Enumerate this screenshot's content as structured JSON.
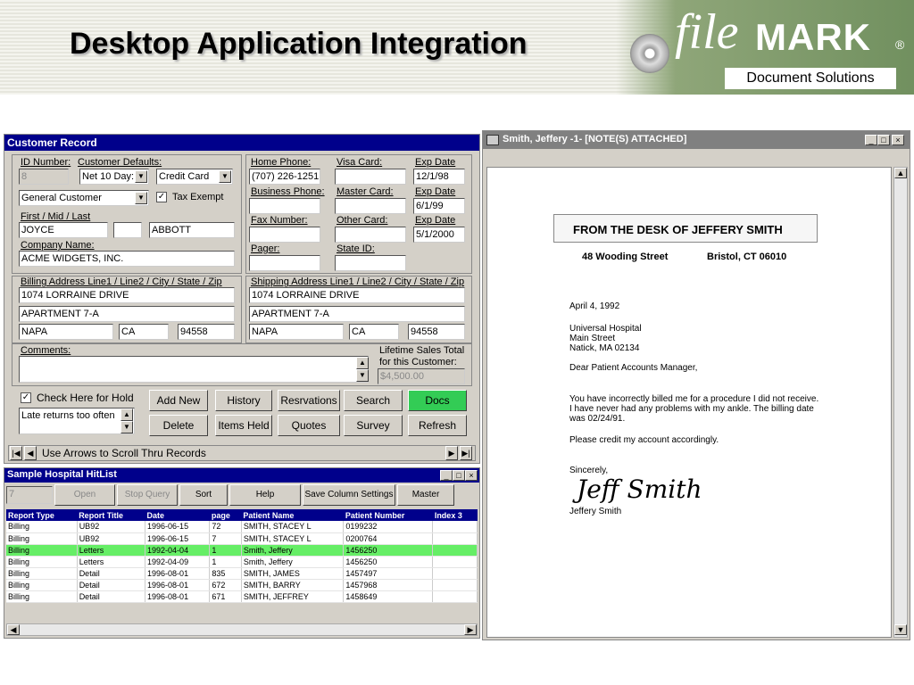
{
  "header": {
    "title": "Desktop Application Integration",
    "logo_file": "file",
    "logo_mark": "MARK",
    "logo_reg": "®",
    "logo_subtitle": "Document Solutions"
  },
  "customer_record": {
    "title": "Customer Record",
    "id_label": "ID Number:",
    "id_value": "8",
    "defaults_label": "Customer Defaults:",
    "terms_value": "Net 10 Day:",
    "payment_value": "Credit Card",
    "customer_type_value": "General Customer",
    "tax_exempt_label": "Tax Exempt",
    "name_label": "First / Mid / Last",
    "first_name": "JOYCE",
    "middle_name": "",
    "last_name": "ABBOTT",
    "company_label": "Company Name:",
    "company_value": "ACME WIDGETS, INC.",
    "home_phone_label": "Home Phone:",
    "home_phone_value": "(707) 226-1251",
    "business_phone_label": "Business Phone:",
    "business_phone_value": "",
    "fax_label": "Fax Number:",
    "fax_value": "",
    "pager_label": "Pager:",
    "pager_value": "",
    "visa_label": "Visa Card:",
    "master_label": "Master Card:",
    "other_label": "Other Card:",
    "state_id_label": "State ID:",
    "exp_label": "Exp Date",
    "exp1": "12/1/98",
    "exp2": "6/1/99",
    "exp3": "5/1/2000",
    "billing_label": "Billing Address Line1 / Line2 / City / State / Zip",
    "billing_line1": "1074 LORRAINE DRIVE",
    "billing_line2": "APARTMENT 7-A",
    "billing_city": "NAPA",
    "billing_state": "CA",
    "billing_zip": "94558",
    "shipping_label": "Shipping Address Line1 / Line2 / City / State / Zip",
    "shipping_line1": "1074 LORRAINE DRIVE",
    "shipping_line2": "APARTMENT 7-A",
    "shipping_city": "NAPA",
    "shipping_state": "CA",
    "shipping_zip": "94558",
    "comments_label": "Comments:",
    "lifetime_label1": "Lifetime Sales Total",
    "lifetime_label2": "for this Customer:",
    "lifetime_value": "$4,500.00",
    "hold_label": "Check Here for Hold",
    "hold_note": "Late returns too often",
    "buttons": {
      "add_new": "Add New",
      "history": "History",
      "reservations": "Resrvations",
      "search": "Search",
      "docs": "Docs",
      "delete": "Delete",
      "items_held": "Items Held",
      "quotes": "Quotes",
      "survey": "Survey",
      "refresh": "Refresh"
    },
    "nav_text": "Use Arrows to Scroll Thru Records"
  },
  "hitlist": {
    "title": "Sample Hospital HitList",
    "count_value": "7",
    "buttons": {
      "open": "Open",
      "stop_query": "Stop Query",
      "sort": "Sort",
      "help": "Help",
      "save_columns": "Save Column Settings",
      "master": "Master"
    },
    "columns": [
      "Report Type",
      "Report Title",
      "Date",
      "page",
      "Patient Name",
      "Patient Number",
      "Index 3"
    ],
    "rows": [
      [
        "Billing",
        "UB92",
        "1996-06-15",
        "72",
        "SMITH, STACEY L",
        "0199232",
        ""
      ],
      [
        "Billing",
        "UB92",
        "1996-06-15",
        "7",
        "SMITH, STACEY L",
        "0200764",
        ""
      ],
      [
        "Billing",
        "Letters",
        "1992-04-04",
        "1",
        "Smith, Jeffery",
        "1456250",
        ""
      ],
      [
        "Billing",
        "Letters",
        "1992-04-09",
        "1",
        "Smith, Jeffery",
        "1456250",
        ""
      ],
      [
        "Billing",
        "Detail",
        "1996-08-01",
        "835",
        "SMITH, JAMES",
        "1457497",
        ""
      ],
      [
        "Billing",
        "Detail",
        "1996-08-01",
        "672",
        "SMITH, BARRY",
        "1457968",
        ""
      ],
      [
        "Billing",
        "Detail",
        "1996-08-01",
        "671",
        "SMITH, JEFFREY",
        "1458649",
        ""
      ]
    ],
    "highlight_color": "#66ee66"
  },
  "document_viewer": {
    "title": "Smith, Jeffery -1-  [NOTE(S) ATTACHED]",
    "letter": {
      "heading": "FROM THE DESK OF JEFFERY SMITH",
      "street": "48 Wooding Street",
      "city": "Bristol, CT 06010",
      "date": "April 4, 1992",
      "recipient1": "Universal Hospital",
      "recipient2": "Main Street",
      "recipient3": "Natick, MA 02134",
      "salutation": "Dear Patient Accounts Manager,",
      "body1": "You have incorrectly billed me for a procedure I did not receive.",
      "body2": "I have never had any problems with my ankle.  The billing date",
      "body3": "was 02/24/91.",
      "body4": "Please credit my account accordingly.",
      "closing": "Sincerely,",
      "signature": "Jeff Smith",
      "signer": "Jeffery Smith"
    }
  },
  "colors": {
    "title_bar": "#00008b",
    "docs_button": "#33cc55",
    "logo_green": "#71905f"
  }
}
